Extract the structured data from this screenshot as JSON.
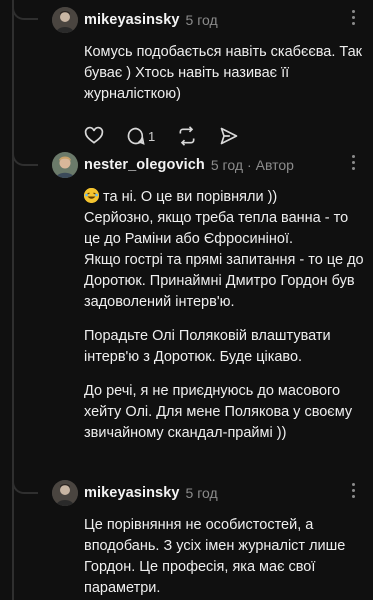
{
  "comments": [
    {
      "username": "mikeyasinsky",
      "time": "5 год",
      "author_tag": "",
      "paragraphs": [
        "Комусь подобається навіть скабєєва. Так буває ) Хтось навіть називає її журналісткою)"
      ],
      "reply_count": "1",
      "avatar_icon": "user-avatar"
    },
    {
      "username": "nester_olegovich",
      "time": "5 год",
      "author_tag": "Автор",
      "emoji": "😂",
      "paragraphs": [
        "та ні. О це ви порівняли ))\nСерйозно, якщо треба тепла ванна - то це до Раміни або Єфросиніної.\nЯкщо гострі та прямі запитання - то це до Доротюк. Принаймні Дмитро Гордон був задоволений інтерв'ю.",
        "Порадьте Олі Поляковій влаштувати інтерв'ю з Доротюк. Буде цікаво.",
        "До речі, я не приєднуюсь до масового хейту Олі. Для мене Полякова у своєму звичайному скандал-праймі ))"
      ],
      "avatar_icon": "user-avatar"
    },
    {
      "username": "mikeyasinsky",
      "time": "5 год",
      "author_tag": "",
      "paragraphs": [
        "Це порівняння не особистостей, а вподобань. З усіх імен журналіст лише Гордон. Це професія, яка має свої параметри."
      ],
      "avatar_icon": "user-avatar"
    }
  ],
  "colors": {
    "background": "#101010",
    "text": "#efefef",
    "muted": "#8b8b8b",
    "thread": "#2f2f2f"
  }
}
